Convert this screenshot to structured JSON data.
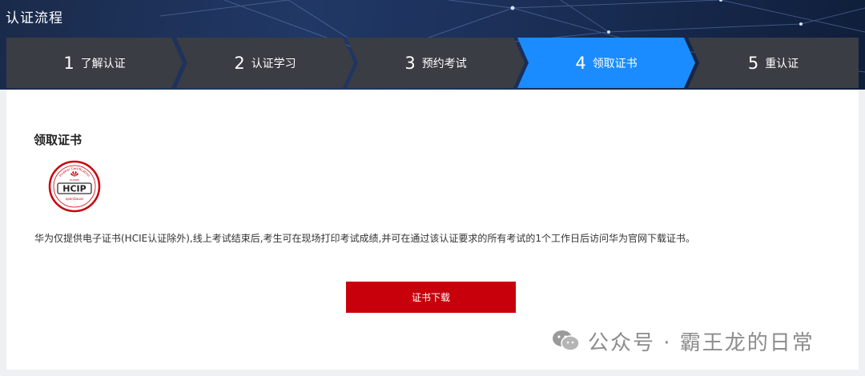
{
  "header": {
    "title": "认证流程"
  },
  "steps": [
    {
      "num": "1",
      "label": "了解认证",
      "active": false
    },
    {
      "num": "2",
      "label": "认证学习",
      "active": false
    },
    {
      "num": "3",
      "label": "预约考试",
      "active": false
    },
    {
      "num": "4",
      "label": "领取证书",
      "active": true
    },
    {
      "num": "5",
      "label": "重认证",
      "active": false
    }
  ],
  "main": {
    "section_title": "领取证书",
    "badge": {
      "arc_text": "Huawei Certification",
      "brand": "HUAWEI",
      "code": "HCIP",
      "product": "openGauss"
    },
    "description": "华为仅提供电子证书(HCIE认证除外),线上考试结束后,考生可在现场打印考试成绩,并可在通过该认证要求的所有考试的1个工作日后访问华为官网下载证书。",
    "download_label": "证书下载"
  },
  "watermark": {
    "text": "公众号 · 霸王龙的日常",
    "icon": "wechat-icon"
  },
  "colors": {
    "active_step": "#1a8cff",
    "inactive_step": "#3a3d43",
    "button": "#c7000b",
    "badge_red": "#c7000b"
  }
}
